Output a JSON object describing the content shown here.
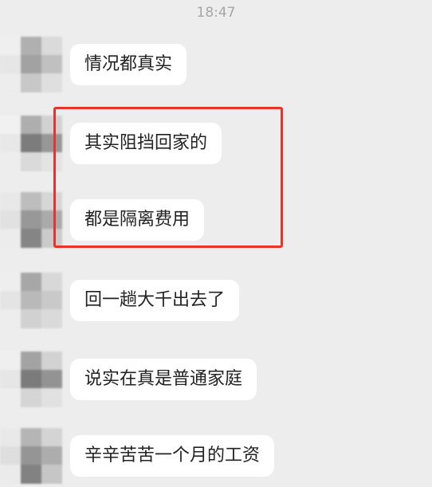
{
  "status": {
    "time": "18:47"
  },
  "messages": [
    {
      "text": "情况都真实"
    },
    {
      "text": "其实阻挡回家的"
    },
    {
      "text": "都是隔离费用"
    },
    {
      "text": "回一趟大千出去了"
    },
    {
      "text": "说实在真是普通家庭"
    },
    {
      "text": "辛辛苦苦一个月的工资"
    }
  ],
  "colors": {
    "background": "#ededed",
    "bubble": "#ffffff",
    "highlight": "#e8322b",
    "timestamp": "#a6a6a6"
  },
  "icons": {
    "avatar": "mosaic-avatar-icon"
  }
}
